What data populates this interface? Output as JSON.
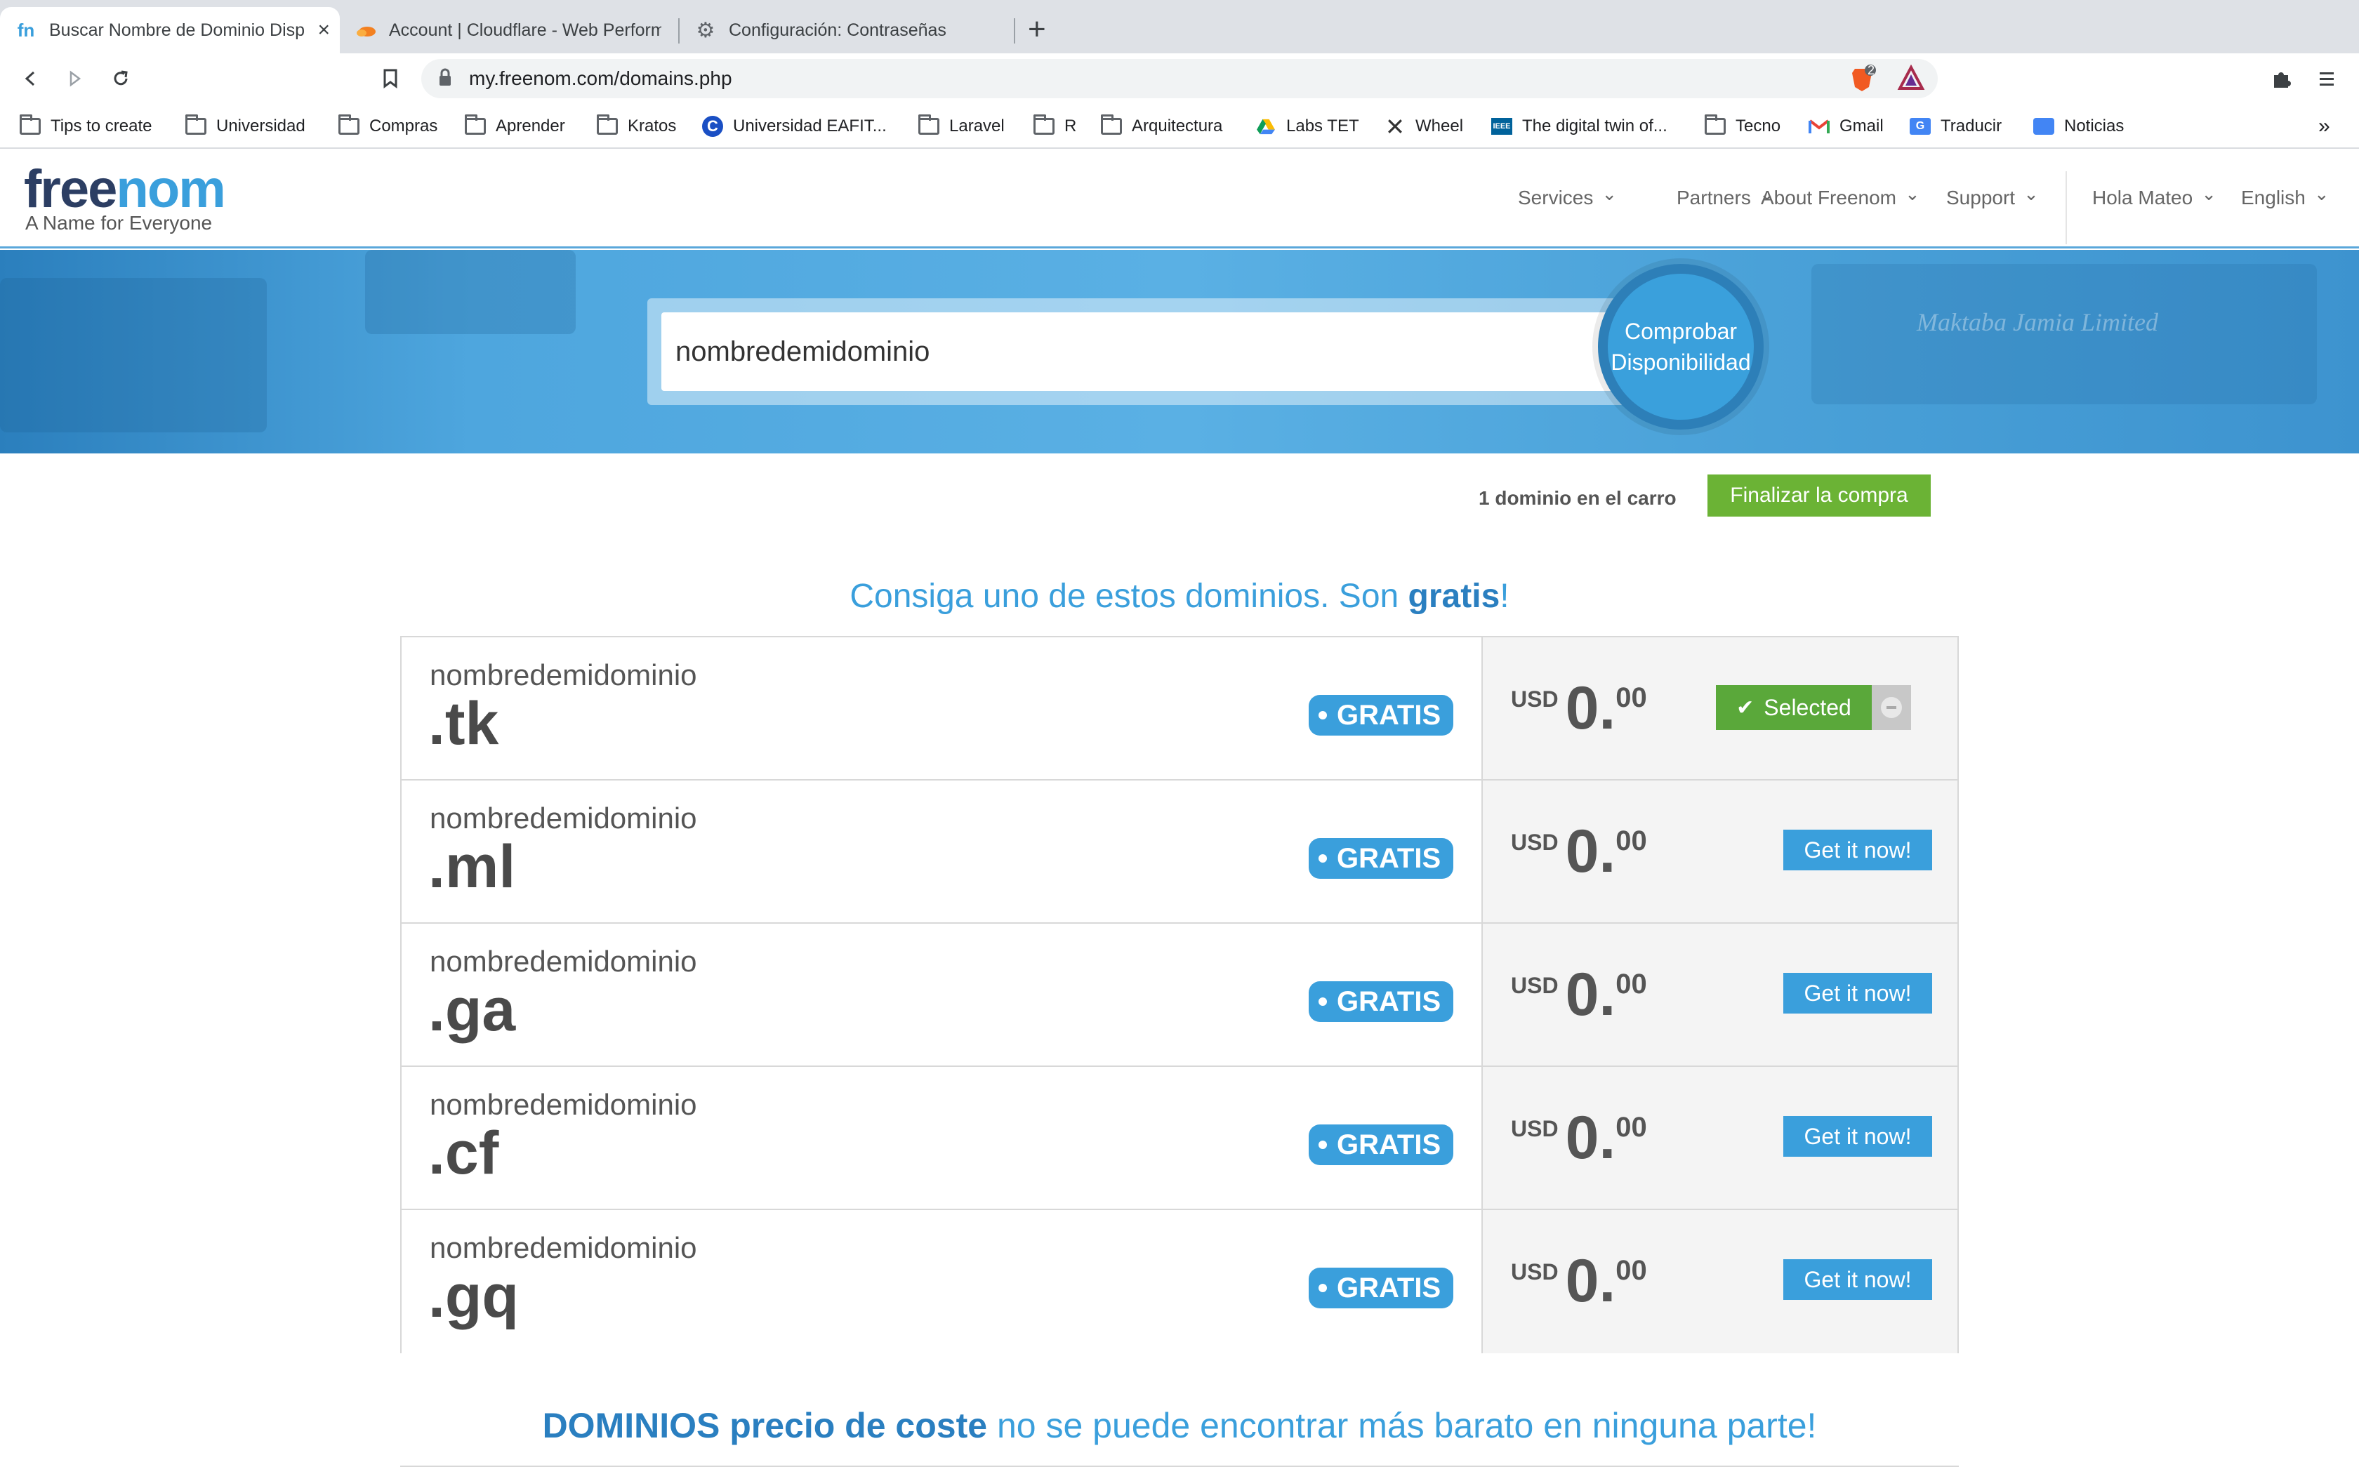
{
  "browser": {
    "tabs": [
      {
        "title": "Buscar Nombre de Dominio Disp",
        "favicon": "freenom-icon",
        "active": true
      },
      {
        "title": "Account | Cloudflare - Web Perform",
        "favicon": "cloudflare-icon",
        "active": false
      },
      {
        "title": "Configuración: Contraseñas",
        "favicon": "gear-icon",
        "active": false
      }
    ],
    "new_tab": "+",
    "url": "my.freenom.com/domains.php",
    "extension_badge": "2",
    "bookmarks": [
      {
        "label": "Tips to create",
        "icon": "folder-icon"
      },
      {
        "label": "Universidad",
        "icon": "folder-icon"
      },
      {
        "label": "Compras",
        "icon": "folder-icon"
      },
      {
        "label": "Aprender",
        "icon": "folder-icon"
      },
      {
        "label": "Kratos",
        "icon": "folder-icon"
      },
      {
        "label": "Universidad EAFIT...",
        "icon": "eafit-icon"
      },
      {
        "label": "Laravel",
        "icon": "folder-icon"
      },
      {
        "label": "R",
        "icon": "folder-icon"
      },
      {
        "label": "Arquitectura",
        "icon": "folder-icon"
      },
      {
        "label": "Labs TET",
        "icon": "drive-icon"
      },
      {
        "label": "Wheel",
        "icon": "tools-icon"
      },
      {
        "label": "The digital twin of...",
        "icon": "ieee-icon"
      },
      {
        "label": "Tecno",
        "icon": "folder-icon"
      },
      {
        "label": "Gmail",
        "icon": "gmail-icon"
      },
      {
        "label": "Traducir",
        "icon": "translate-icon"
      },
      {
        "label": "Noticias",
        "icon": "news-icon"
      }
    ],
    "bookmarks_overflow": "»"
  },
  "site": {
    "logo": {
      "part1": "free",
      "part2": "nom"
    },
    "tagline": "A Name for Everyone",
    "nav": [
      "Services",
      "Partners",
      "About Freenom",
      "Support",
      "Hola Mateo",
      "English"
    ],
    "search": {
      "value": "nombredemidominio",
      "button": "Comprobar Disponibilidad"
    },
    "hero_watermark": "Maktaba Jamia Limited",
    "cart": {
      "text": "1 dominio en el carro",
      "checkout": "Finalizar la compra"
    },
    "section_title": {
      "pre": "Consiga uno de estos dominios. Son ",
      "bold": "gratis",
      "post": "!"
    },
    "domains": [
      {
        "name": "nombredemidominio",
        "tld": ".tk",
        "badge": "GRATIS",
        "currency": "USD",
        "price_int": "0.",
        "price_dec": "00",
        "action": "Selected",
        "selected": true
      },
      {
        "name": "nombredemidominio",
        "tld": ".ml",
        "badge": "GRATIS",
        "currency": "USD",
        "price_int": "0.",
        "price_dec": "00",
        "action": "Get it now!",
        "selected": false
      },
      {
        "name": "nombredemidominio",
        "tld": ".ga",
        "badge": "GRATIS",
        "currency": "USD",
        "price_int": "0.",
        "price_dec": "00",
        "action": "Get it now!",
        "selected": false
      },
      {
        "name": "nombredemidominio",
        "tld": ".cf",
        "badge": "GRATIS",
        "currency": "USD",
        "price_int": "0.",
        "price_dec": "00",
        "action": "Get it now!",
        "selected": false
      },
      {
        "name": "nombredemidominio",
        "tld": ".gq",
        "badge": "GRATIS",
        "currency": "USD",
        "price_int": "0.",
        "price_dec": "00",
        "action": "Get it now!",
        "selected": false
      }
    ],
    "bottom_title": {
      "bold": "DOMINIOS precio de coste",
      "rest": " no se puede encontrar más barato en ninguna parte!"
    }
  },
  "colors": {
    "accent": "#3a9fdc",
    "brand_dark": "#2c3e63",
    "success": "#6bb335",
    "selected": "#5aa83a"
  }
}
